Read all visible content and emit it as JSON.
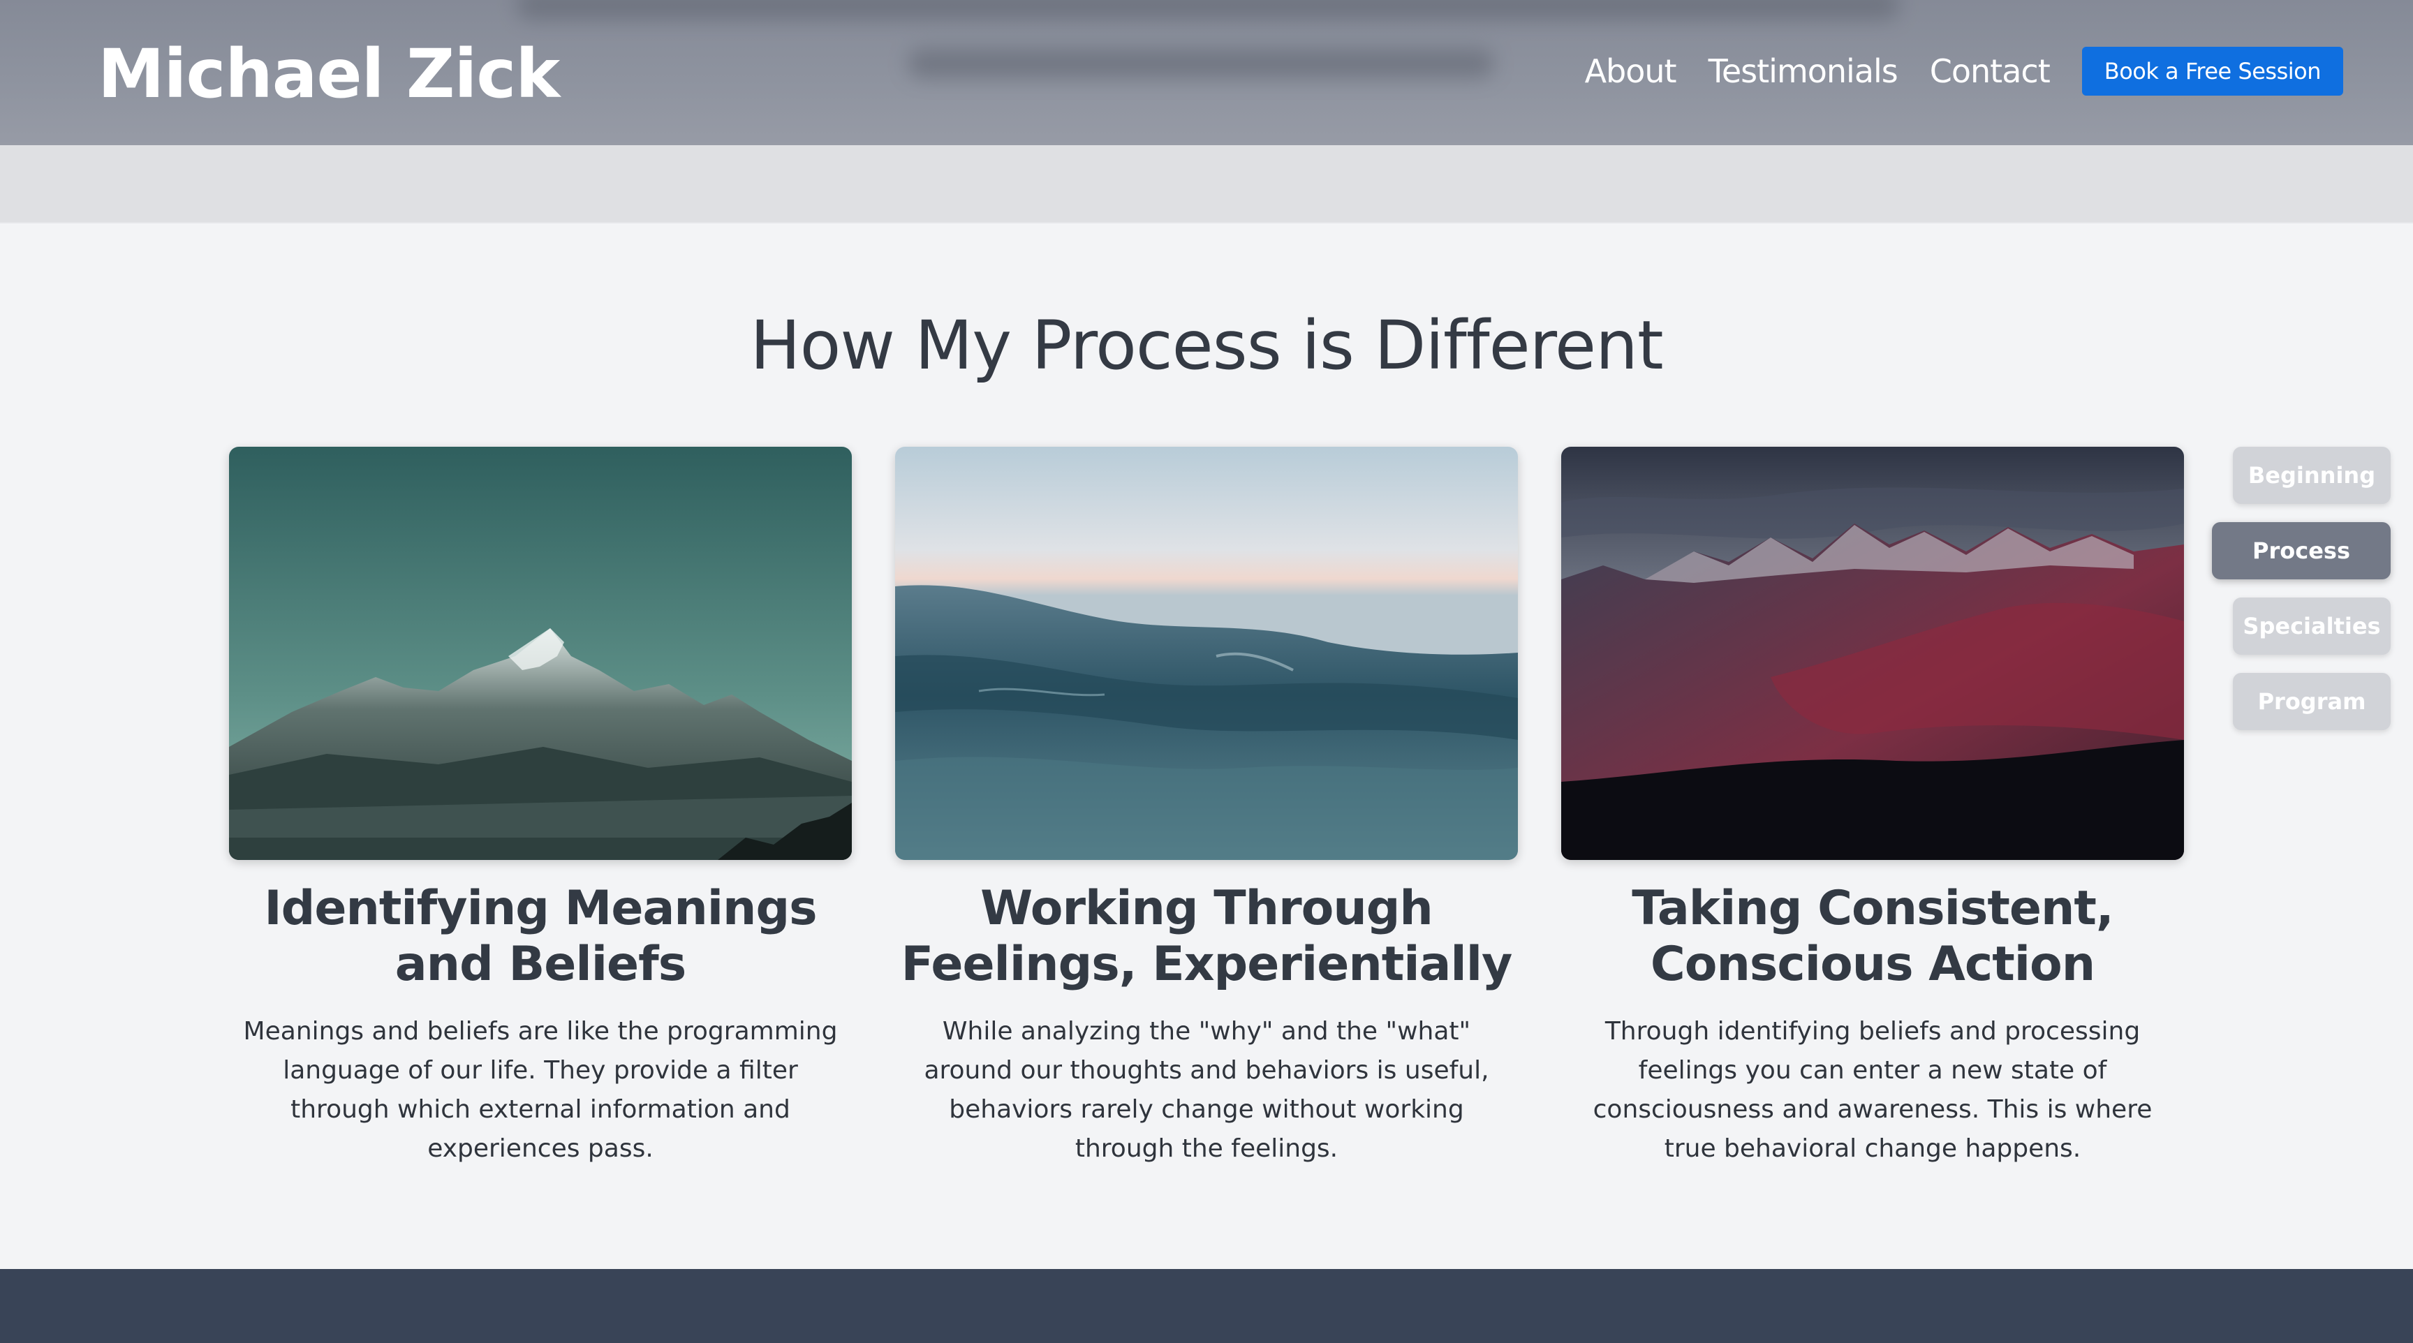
{
  "header": {
    "brand": "Michael Zick",
    "nav": [
      {
        "label": "About"
      },
      {
        "label": "Testimonials"
      },
      {
        "label": "Contact"
      }
    ],
    "cta_label": "Book a Free Session"
  },
  "process": {
    "title": "How My Process is Different",
    "cards": [
      {
        "title": "Identifying Meanings and Beliefs",
        "text": "Meanings and beliefs are like the programming language of our life. They provide a filter through which external information and experiences pass."
      },
      {
        "title": "Working Through Feelings, Experientially",
        "text": "While analyzing the \"why\" and the \"what\" around our thoughts and behaviors is useful, behaviors rarely change without working through the feelings."
      },
      {
        "title": "Taking Consistent, Conscious Action",
        "text": "Through identifying beliefs and processing feelings you can enter a new state of consciousness and awareness. This is where true behavioral change happens."
      }
    ]
  },
  "side_nav": {
    "items": [
      {
        "label": "Beginning",
        "active": false
      },
      {
        "label": "Process",
        "active": true
      },
      {
        "label": "Specialties",
        "active": false
      },
      {
        "label": "Program",
        "active": false
      }
    ]
  },
  "colors": {
    "cta": "#0f6fe0",
    "side_active": "#737987",
    "side_inactive": "#d1d3d8",
    "footer": "#394457"
  }
}
